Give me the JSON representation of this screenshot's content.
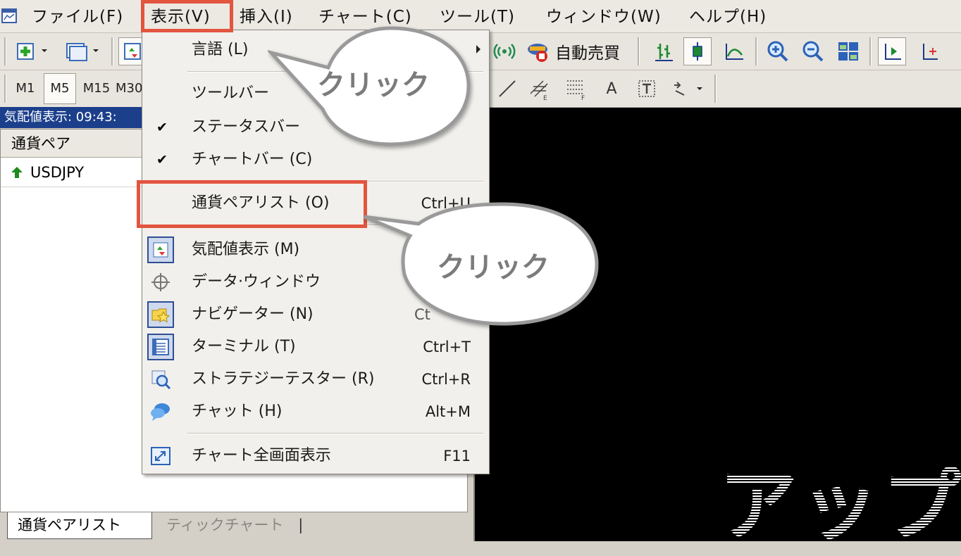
{
  "menubar": {
    "items": [
      "ファイル(F)",
      "表示(V)",
      "挿入(I)",
      "チャート(C)",
      "ツール(T)",
      "ウィンドウ(W)",
      "ヘルプ(H)"
    ]
  },
  "toolbar": {
    "auto_trade_label": "自動売買"
  },
  "timeframes": [
    "M1",
    "M5",
    "M15",
    "M30"
  ],
  "market_watch": {
    "title": "気配値表示: 09:43:",
    "column_header": "通貨ペア",
    "symbols": [
      {
        "name": "USDJPY",
        "direction": "up",
        "color": "#1e8a1e"
      }
    ],
    "tabs": [
      "通貨ペアリスト",
      "ティックチャート"
    ]
  },
  "view_menu": {
    "items": [
      {
        "label": "言語 (L)",
        "submenu": true
      },
      {
        "label": "ツールバー",
        "submenu": false
      },
      {
        "label": "ステータスバー",
        "checked": true
      },
      {
        "label": "チャートバー (C)",
        "checked": true
      },
      {
        "label": "通貨ペアリスト (O)",
        "shortcut": "Ctrl+U"
      },
      {
        "label": "気配値表示 (M)",
        "icon": "market-watch-icon"
      },
      {
        "label": "データ·ウィンドウ",
        "icon": "crosshair-icon"
      },
      {
        "label": "ナビゲーター (N)",
        "shortcut": "Ct",
        "icon": "navigator-folder-icon"
      },
      {
        "label": "ターミナル (T)",
        "shortcut": "Ctrl+T",
        "icon": "terminal-icon"
      },
      {
        "label": "ストラテジーテスター (R)",
        "shortcut": "Ctrl+R",
        "icon": "strategy-tester-icon"
      },
      {
        "label": "チャット (H)",
        "shortcut": "Alt+M",
        "icon": "chat-icon"
      },
      {
        "label": "チャート全画面表示",
        "shortcut": "F11",
        "icon": "fullscreen-icon"
      }
    ]
  },
  "callouts": [
    "クリック",
    "クリック"
  ],
  "chart": {
    "watermark": "アップ"
  },
  "colors": {
    "highlight": "#e2553f",
    "title_bar": "#1c3f8c",
    "chart_bg": "#000000"
  }
}
